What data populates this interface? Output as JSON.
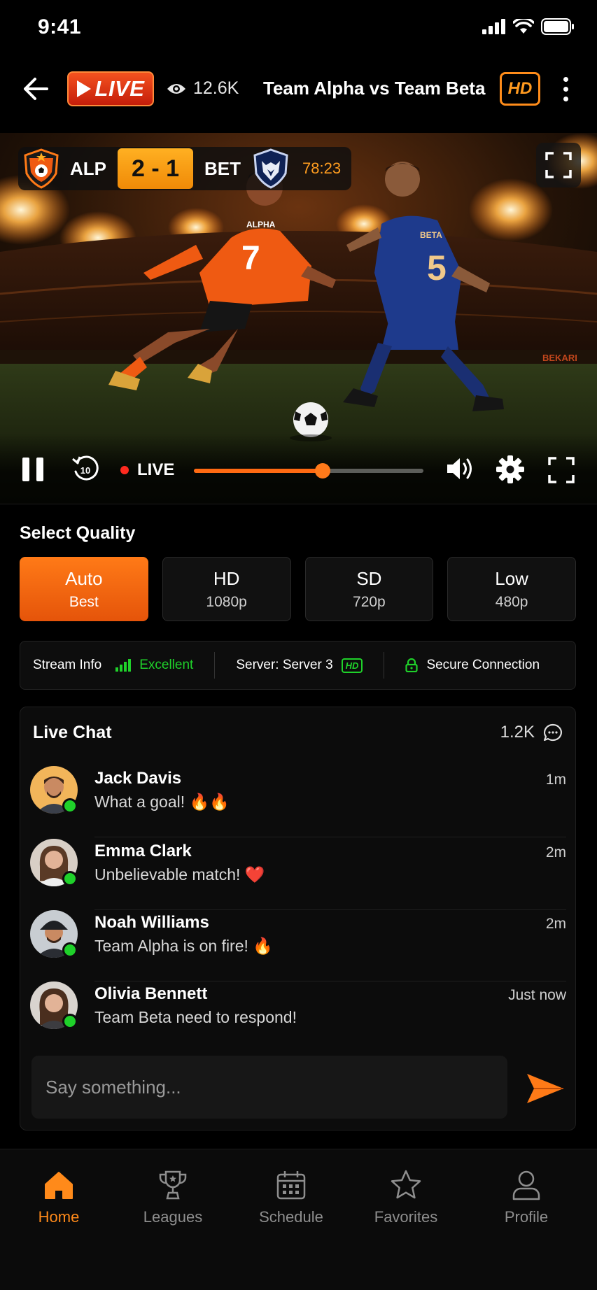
{
  "status_bar": {
    "time": "9:41"
  },
  "header": {
    "live_label": "LIVE",
    "viewers": "12.6K",
    "title": "Team Alpha vs Team Beta",
    "quality_badge": "HD"
  },
  "scoreboard": {
    "home_code": "ALP",
    "away_code": "BET",
    "score": "2 - 1",
    "clock": "78:23"
  },
  "video": {
    "home_jersey_name": "ALPHA",
    "home_jersey_number": "7",
    "away_jersey_name": "BETA",
    "away_jersey_number": "5",
    "ad_board": "BEKARI"
  },
  "player": {
    "rewind_seconds": "10",
    "live_label": "LIVE",
    "progress": 0.56
  },
  "quality": {
    "title": "Select Quality",
    "options": [
      {
        "label": "Auto",
        "sub": "Best",
        "active": true
      },
      {
        "label": "HD",
        "sub": "1080p",
        "active": false
      },
      {
        "label": "SD",
        "sub": "720p",
        "active": false
      },
      {
        "label": "Low",
        "sub": "480p",
        "active": false
      }
    ]
  },
  "stream_info": {
    "label": "Stream Info",
    "signal": "Excellent",
    "server": "Server: Server 3",
    "server_badge": "HD",
    "connection": "Secure Connection"
  },
  "chat": {
    "title": "Live Chat",
    "count": "1.2K",
    "messages": [
      {
        "name": "Jack Davis",
        "text": "What a goal! 🔥🔥",
        "time": "1m"
      },
      {
        "name": "Emma Clark",
        "text": "Unbelievable match! ❤️",
        "time": "2m"
      },
      {
        "name": "Noah Williams",
        "text": "Team Alpha is on fire! 🔥",
        "time": "2m"
      },
      {
        "name": "Olivia Bennett",
        "text": "Team Beta need to respond!",
        "time": "Just now"
      }
    ],
    "input_placeholder": "Say something..."
  },
  "nav": {
    "items": [
      {
        "label": "Home",
        "icon": "home-icon",
        "active": true
      },
      {
        "label": "Leagues",
        "icon": "trophy-icon",
        "active": false
      },
      {
        "label": "Schedule",
        "icon": "calendar-icon",
        "active": false
      },
      {
        "label": "Favorites",
        "icon": "star-icon",
        "active": false
      },
      {
        "label": "Profile",
        "icon": "user-icon",
        "active": false
      }
    ]
  },
  "colors": {
    "accent": "#ff7a17",
    "live_red": "#e5281a",
    "success": "#1fd12a",
    "background": "#000000"
  }
}
